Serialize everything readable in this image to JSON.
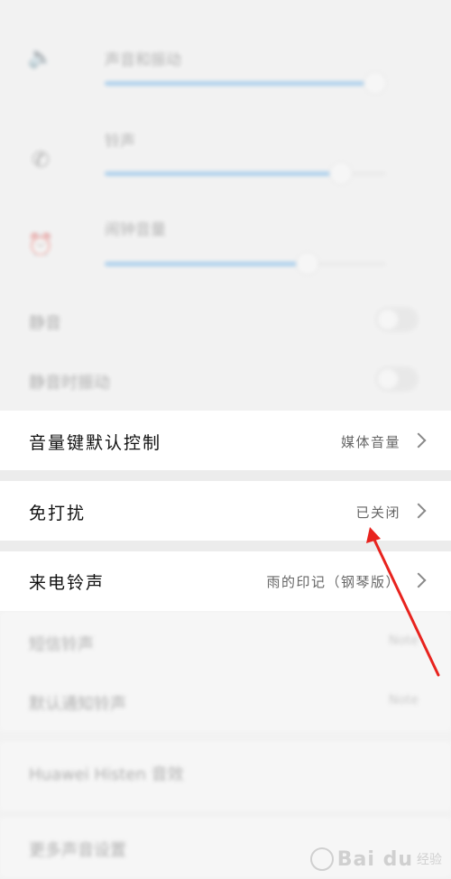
{
  "volume_sliders": [
    {
      "icon": "volume-icon",
      "label": "声音和振动",
      "level": 0.96
    },
    {
      "icon": "phone-icon",
      "label": "铃声",
      "level": 0.84
    },
    {
      "icon": "alarm-icon",
      "label": "闹钟音量",
      "level": 0.72
    }
  ],
  "faded_rows": [
    {
      "label": "静音"
    },
    {
      "label": "静音时振动"
    }
  ],
  "settings": {
    "volume_key": {
      "title": "音量键默认控制",
      "value": "媒体音量"
    },
    "dnd": {
      "title": "免打扰",
      "value": "已关闭"
    },
    "ringtone": {
      "title": "来电铃声",
      "value": "雨的印记（钢琴版）"
    }
  },
  "faded_bottom": [
    {
      "label": "短信铃声",
      "value": "Note"
    },
    {
      "label": "默认通知铃声",
      "value": "Note"
    },
    {
      "label": "Huawei Histen 音效"
    },
    {
      "label": "更多声音设置"
    }
  ],
  "annotation": {
    "color": "#e8231e"
  },
  "watermark": {
    "logo": "Bai du",
    "sub": "经验"
  }
}
